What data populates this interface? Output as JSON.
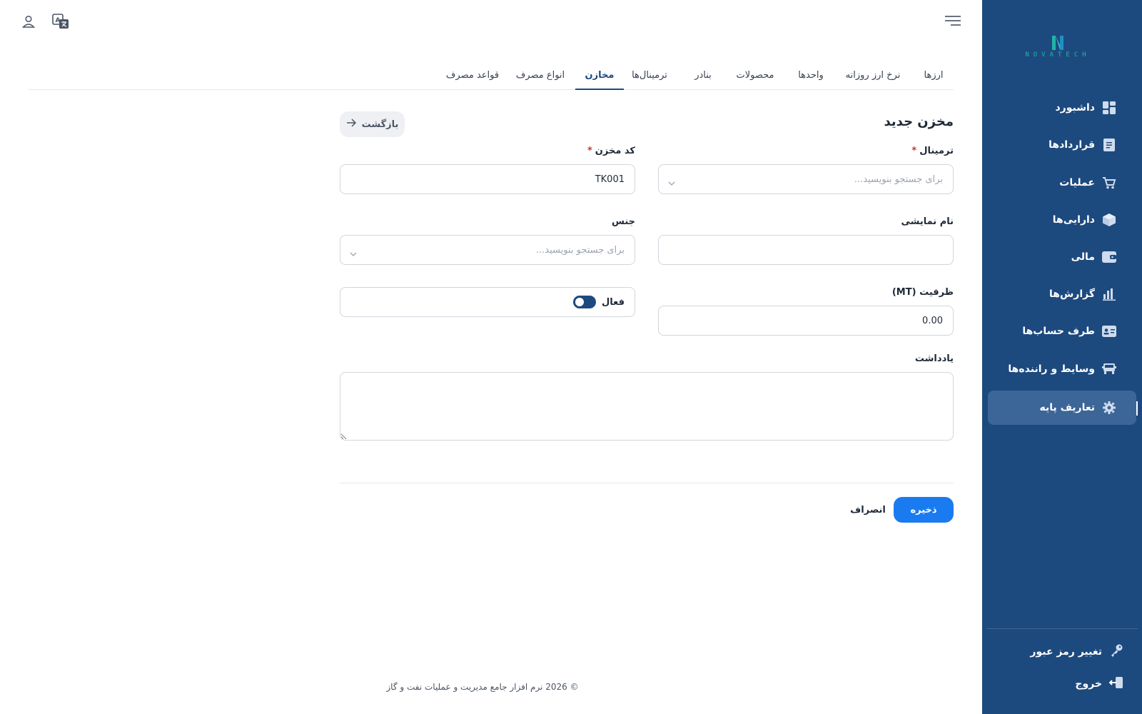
{
  "brand": {
    "logo_text": "NOVATECH"
  },
  "sidebar": {
    "items": [
      {
        "label": "داشبورد",
        "icon": "dashboard-icon"
      },
      {
        "label": "قراردادها",
        "icon": "document-icon"
      },
      {
        "label": "عملیات",
        "icon": "cart-icon"
      },
      {
        "label": "دارایی‌ها",
        "icon": "box-icon"
      },
      {
        "label": "مالی",
        "icon": "wallet-icon"
      },
      {
        "label": "گزارش‌ها",
        "icon": "bar-chart-icon"
      },
      {
        "label": "طرف حساب‌ها",
        "icon": "contact-card-icon"
      },
      {
        "label": "وسایط و راننده‌ها",
        "icon": "truck-icon"
      },
      {
        "label": "تعاریف پایه",
        "icon": "gear-icon",
        "active": true
      }
    ],
    "change_password": "تغییر رمز عبور",
    "logout": "خروج"
  },
  "tabs": [
    "ارزها",
    "نرخ ارز روزانه",
    "واحدها",
    "محصولات",
    "بنادر",
    "ترمینال‌ها",
    "مخازن",
    "انواع مصرف",
    "قواعد مصرف"
  ],
  "active_tab": "مخازن",
  "form": {
    "title": "مخزن جدید",
    "back_label": "بازگشت",
    "terminal": {
      "label": "ترمینال",
      "placeholder": "برای جستجو بنویسید..."
    },
    "tank_code": {
      "label": "کد مخزن",
      "value": "TK001"
    },
    "display_name": {
      "label": "نام نمایشی",
      "value": ""
    },
    "material": {
      "label": "جنس",
      "placeholder": "برای جستجو بنویسید..."
    },
    "capacity": {
      "label": "ظرفیت (MT)",
      "value": "0.00"
    },
    "active_toggle": {
      "label": "فعال",
      "on": true
    },
    "note": {
      "label": "یادداشت",
      "value": ""
    },
    "required_mark": "*",
    "save_label": "ذخیره",
    "cancel_label": "انصراف"
  },
  "footer": {
    "text": "© 2026 نرم افزار جامع مدیریت و عملیات نفت و گاز"
  },
  "colors": {
    "sidebar_bg": "#1d4a7e",
    "sidebar_active": "#3c6598",
    "primary_button": "#1a7bf0",
    "required": "#c0392b",
    "accent_teal": "#22b3a8"
  }
}
